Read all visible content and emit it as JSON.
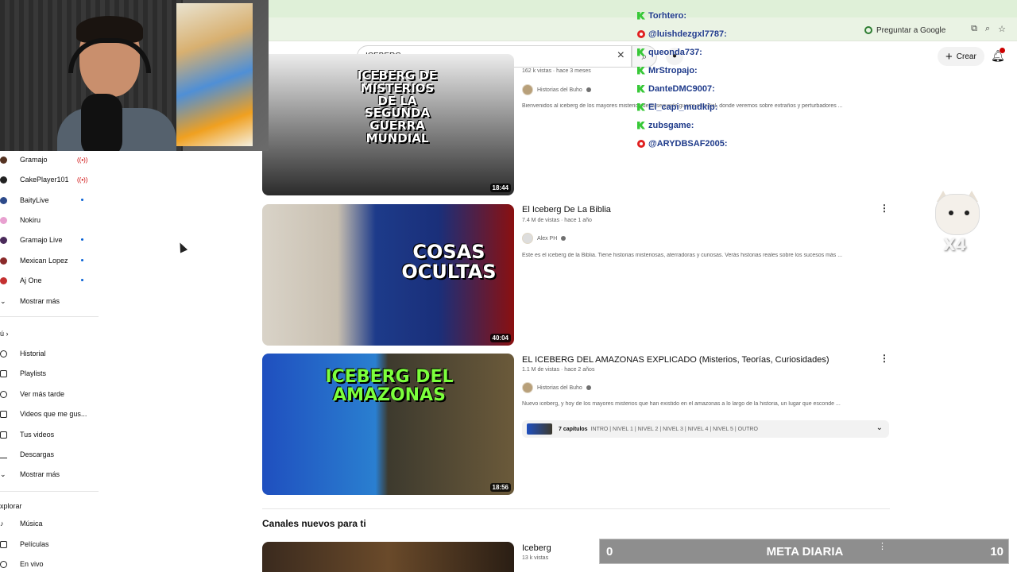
{
  "browser": {
    "ask_google": "Preguntar a Google"
  },
  "header": {
    "search_value": "ICEBERG",
    "create_label": "Crear"
  },
  "chat": [
    {
      "platform": "kick",
      "user": "Torhtero:",
      "msg": ""
    },
    {
      "platform": "youtube",
      "user": "@luishdezgxl7787:",
      "msg": ""
    },
    {
      "platform": "kick",
      "user": "queonda737:",
      "msg": ""
    },
    {
      "platform": "kick",
      "user": "MrStropajo:",
      "msg": ""
    },
    {
      "platform": "kick",
      "user": "DanteDMC9007:",
      "msg": ""
    },
    {
      "platform": "kick",
      "user": "El_capi_mudkip:",
      "msg": ""
    },
    {
      "platform": "kick",
      "user": "zubsgame:",
      "msg": ""
    },
    {
      "platform": "youtube",
      "user": "@ARYDBSAF2005:",
      "msg": ""
    }
  ],
  "sidebar": {
    "subscriptions": [
      {
        "label": "Gramajo",
        "badge": "((•))"
      },
      {
        "label": "CakePlayer101",
        "badge": "((•))"
      },
      {
        "label": "BaityLive",
        "badge": "dot"
      },
      {
        "label": "Nokiru",
        "badge": ""
      },
      {
        "label": "Gramajo Live",
        "badge": "dot"
      },
      {
        "label": "Mexican Lopez",
        "badge": "dot"
      },
      {
        "label": "Aj One",
        "badge": "dot"
      }
    ],
    "show_more_1": "Mostrar más",
    "you_header": "ú  ›",
    "you_items": [
      "Historial",
      "Playlists",
      "Ver más tarde",
      "Videos que me gus...",
      "Tus videos",
      "Descargas"
    ],
    "show_more_2": "Mostrar más",
    "explore_header": "xplorar",
    "explore_items": [
      "Música",
      "Películas",
      "En vivo"
    ]
  },
  "videos": [
    {
      "title": "",
      "meta": "162 k vistas · hace 3 meses",
      "channel": "Historias del Buho",
      "desc": "Bienvenidos al iceberg de los mayores misterios de la segunda guerra mundial, donde veremos sobre extraños y perturbadores ...",
      "duration": "18:44",
      "thumb_text": "ICEBERG DE MISTERIOS DE LA SEGUNDA GUERRA MUNDIAL"
    },
    {
      "title": "El Iceberg De La Biblia",
      "meta": "7.4 M de vistas · hace 1 año",
      "channel": "Alex PH",
      "desc": "Este es el iceberg de la Biblia. Tiene historias misteriosas, aterradoras y curiosas. Verás historias reales sobre los sucesos más ...",
      "duration": "40:04",
      "thumb_text": "COSAS OCULTAS"
    },
    {
      "title": "EL ICEBERG DEL AMAZONAS EXPLICADO (Misterios, Teorías, Curiosidades)",
      "meta": "1.1 M de vistas · hace 2 años",
      "channel": "Historias del Buho",
      "desc": "Nuevo iceberg, y hoy de los mayores misterios que han existido en el amazonas a lo largo de la historia, un lugar que esconde ...",
      "duration": "18:56",
      "thumb_text": "ICEBERG DEL AMAZONAS",
      "chapters_count": "7 capítulos",
      "chapters_list": "INTRO | NIVEL 1 | NIVEL 2 | NIVEL 3 | NIVEL 4 | NIVEL 5 | OUTRO"
    }
  ],
  "new_channels": {
    "section_title": "Canales nuevos para ti",
    "channel_name": "Iceberg",
    "channel_meta": "13 k vistas"
  },
  "overlay": {
    "cat_label": "X4",
    "goal_min": "0",
    "goal_label": "META DIARIA",
    "goal_max": "10"
  }
}
